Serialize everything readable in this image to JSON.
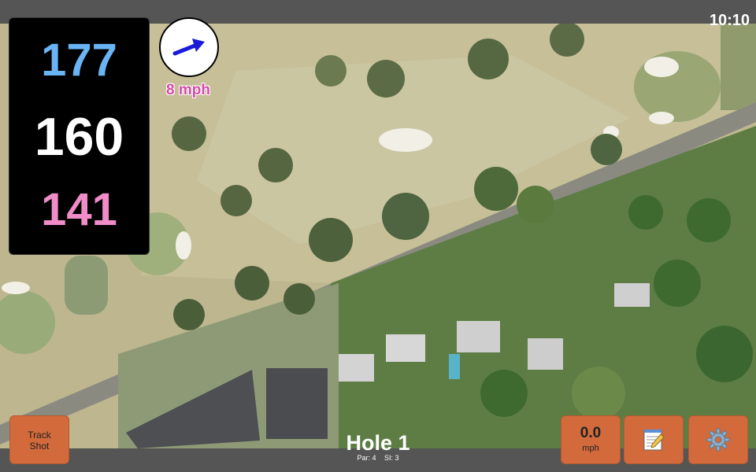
{
  "status_bar": {
    "time": "10:10"
  },
  "distances": {
    "back": "177",
    "middle": "160",
    "front": "141"
  },
  "wind": {
    "speed": "8 mph",
    "icon": "arrow-icon"
  },
  "hole": {
    "title": "Hole 1",
    "par": "Par: 4",
    "si": "SI: 3"
  },
  "buttons": {
    "track_shot_line1": "Track",
    "track_shot_line2": "Shot",
    "speed_value": "0.0",
    "speed_unit": "mph",
    "notes_icon": "notepad-icon",
    "settings_icon": "gear-icon"
  },
  "colors": {
    "back_distance": "#6ab4f5",
    "middle_distance": "#ffffff",
    "front_distance": "#f08cc8",
    "wind_text": "#d54aa8",
    "button_bg": "#d26a3c"
  }
}
